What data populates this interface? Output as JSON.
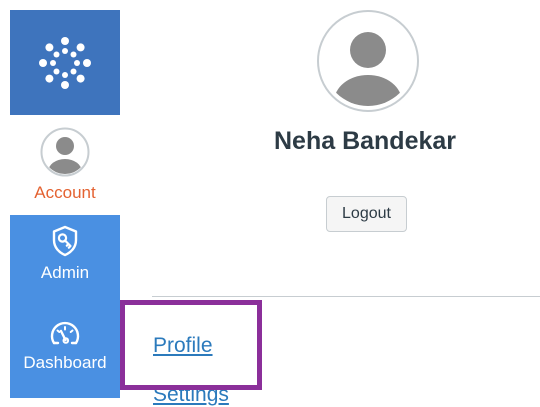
{
  "nav": {
    "logo_icon": "canvas-logo-icon",
    "items": [
      {
        "label": "Account",
        "icon": "user-avatar-icon",
        "active": true
      },
      {
        "label": "Admin",
        "icon": "shield-key-icon"
      },
      {
        "label": "Dashboard",
        "icon": "speedometer-icon"
      }
    ]
  },
  "tray": {
    "user_name": "Neha Bandekar",
    "logout_label": "Logout",
    "links": [
      {
        "label": "Profile"
      },
      {
        "label": "Settings"
      }
    ]
  },
  "colors": {
    "brand": "#3e74bd",
    "nav_bg": "#4a90e2",
    "active_label": "#e46231",
    "link": "#2b7abc",
    "highlight": "#8b2f9a"
  }
}
